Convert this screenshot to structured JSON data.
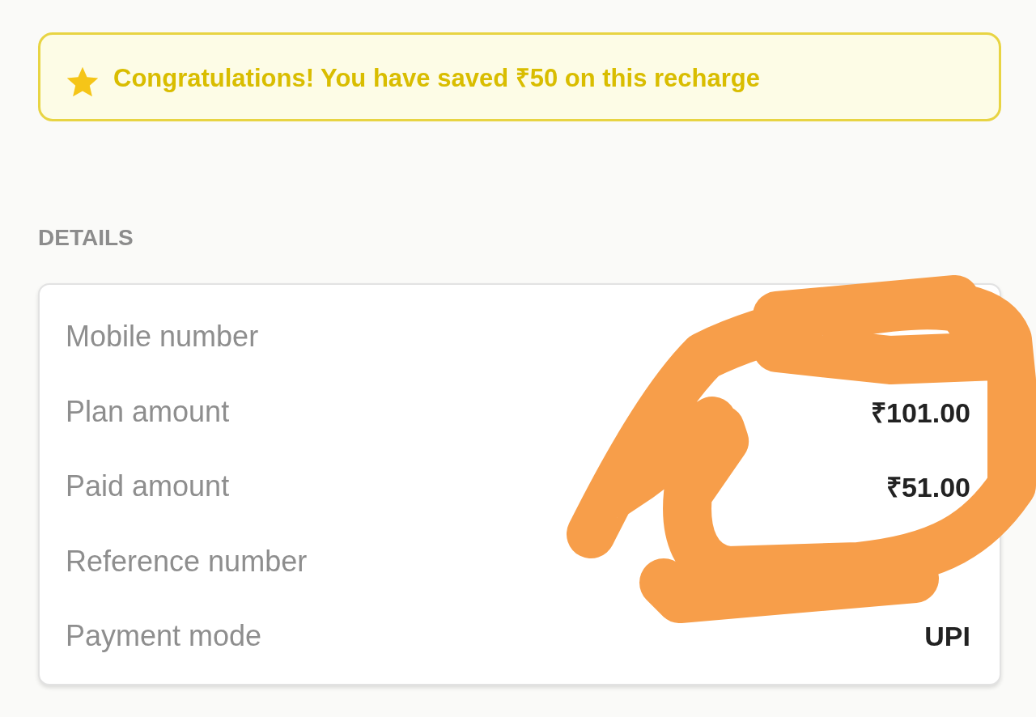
{
  "banner": {
    "text": "Congratulations! You have saved ₹50 on this recharge"
  },
  "section_title": "DETAILS",
  "details": [
    {
      "label": "Mobile number"
    },
    {
      "label": "Plan amount",
      "value": "₹101.00"
    },
    {
      "label": "Paid amount",
      "value": "₹51.00"
    },
    {
      "label": "Reference number"
    },
    {
      "label": "Payment mode",
      "value": "UPI"
    }
  ]
}
